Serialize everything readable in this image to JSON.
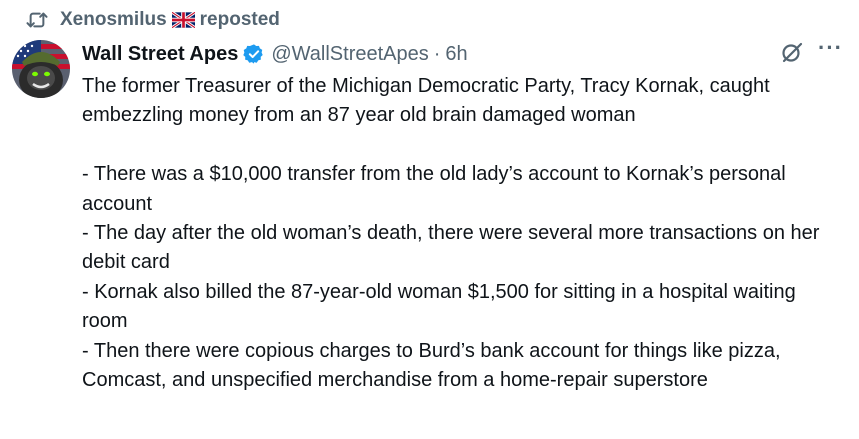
{
  "repost": {
    "icon": "repost-icon",
    "user": "Xenosmilus",
    "flag_icon": "uk-flag-icon",
    "label": "reposted"
  },
  "author": {
    "avatar": "gorilla-avatar",
    "name": "Wall Street Apes",
    "verified_icon": "verified-badge-icon",
    "handle": "@WallStreetApes",
    "separator": "·",
    "time": "6h"
  },
  "actions": {
    "grok_icon": "grok-icon",
    "more_label": "···"
  },
  "tweet": {
    "intro": "The former Treasurer of the Michigan Democratic Party, Tracy Kornak, caught embezzling money from an 87 year old brain damaged woman",
    "bullets": [
      "- There was a $10,000 transfer from the old lady’s account to Kornak’s personal account",
      "- The day after the old woman’s death, there were several more transactions on her debit card",
      "- Kornak also billed the 87-year-old woman $1,500 for sitting in a hospital waiting room",
      "- Then there were copious charges to Burd’s bank account for things like pizza, Comcast, and unspecified merchandise from a home-repair superstore"
    ]
  },
  "colors": {
    "text": "#0f1419",
    "secondary": "#536471",
    "verified": "#1d9bf0"
  }
}
